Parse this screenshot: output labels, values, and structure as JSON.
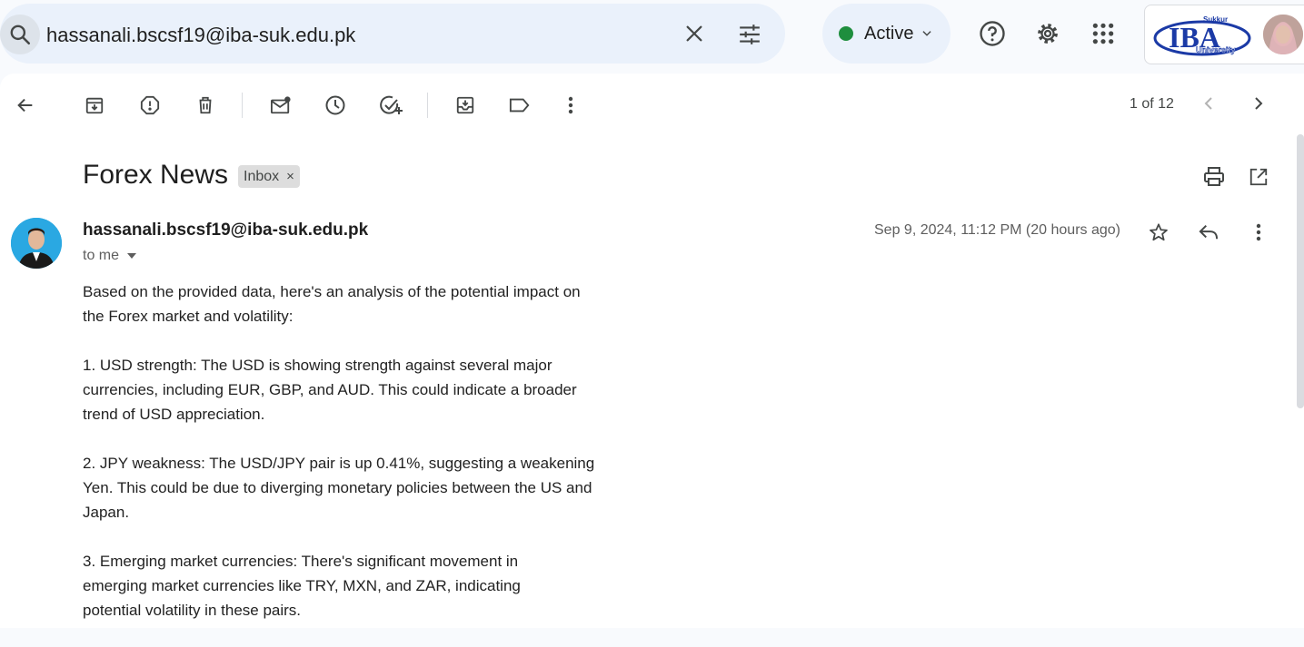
{
  "search": {
    "query": "hassanali.bscsf19@iba-suk.edu.pk"
  },
  "status": {
    "label": "Active",
    "color": "#1e8e3e"
  },
  "header_icons": [
    "help-icon",
    "settings-icon",
    "apps-grid-icon"
  ],
  "account": {
    "logo_top": "Sukkur",
    "logo_main": "IBA",
    "logo_bottom": "University"
  },
  "toolbar": {
    "icons": [
      "back-arrow-icon",
      "archive-icon",
      "report-spam-icon",
      "delete-icon",
      "mark-unread-icon",
      "snooze-icon",
      "add-task-icon",
      "move-to-icon",
      "label-icon",
      "more-icon"
    ],
    "pager": "1 of 12"
  },
  "email": {
    "subject": "Forex News",
    "label": "Inbox",
    "label_remove": "×",
    "sender": "hassanali.bscsf19@iba-suk.edu.pk",
    "to": "to me",
    "date": "Sep 9, 2024, 11:12 PM (20 hours ago)",
    "paragraphs": [
      "Based on the provided data, here's an analysis of the potential impact on the Forex market and volatility:",
      "1. USD strength: The USD is showing strength against several major currencies, including EUR, GBP, and AUD. This could indicate a broader trend of USD appreciation.",
      "2. JPY weakness: The USD/JPY pair is up 0.41%, suggesting a weakening Yen. This could be due to diverging monetary policies between the US and Japan.",
      "3. Emerging market currencies: There's significant movement in emerging market currencies like TRY, MXN, and ZAR, indicating potential volatility in these pairs."
    ]
  }
}
